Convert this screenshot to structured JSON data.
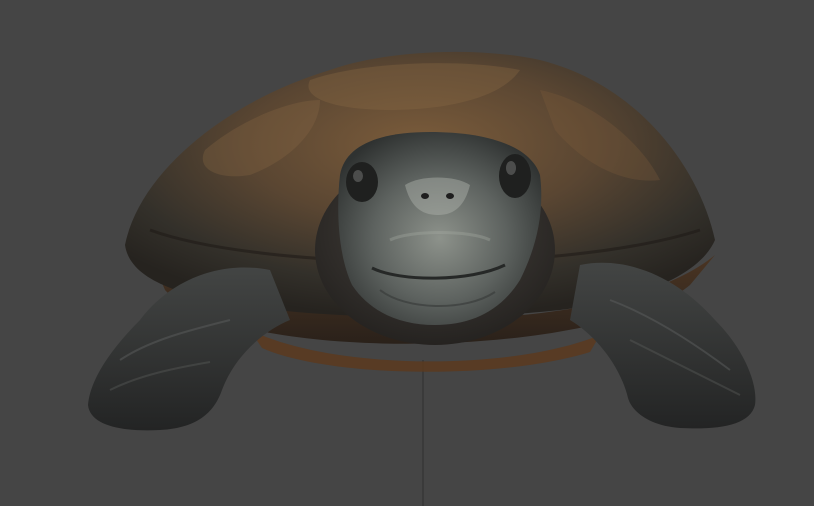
{
  "scene": {
    "background_color": "#454545",
    "subject": "tortoise-model",
    "colors": {
      "shell_light": "#8a6a45",
      "shell_dark": "#2b2620",
      "shell_rim": "#6b4a2a",
      "skin_light": "#8f948c",
      "skin_dark": "#2d2f2e",
      "axis_line": "#2a2a2a"
    }
  }
}
